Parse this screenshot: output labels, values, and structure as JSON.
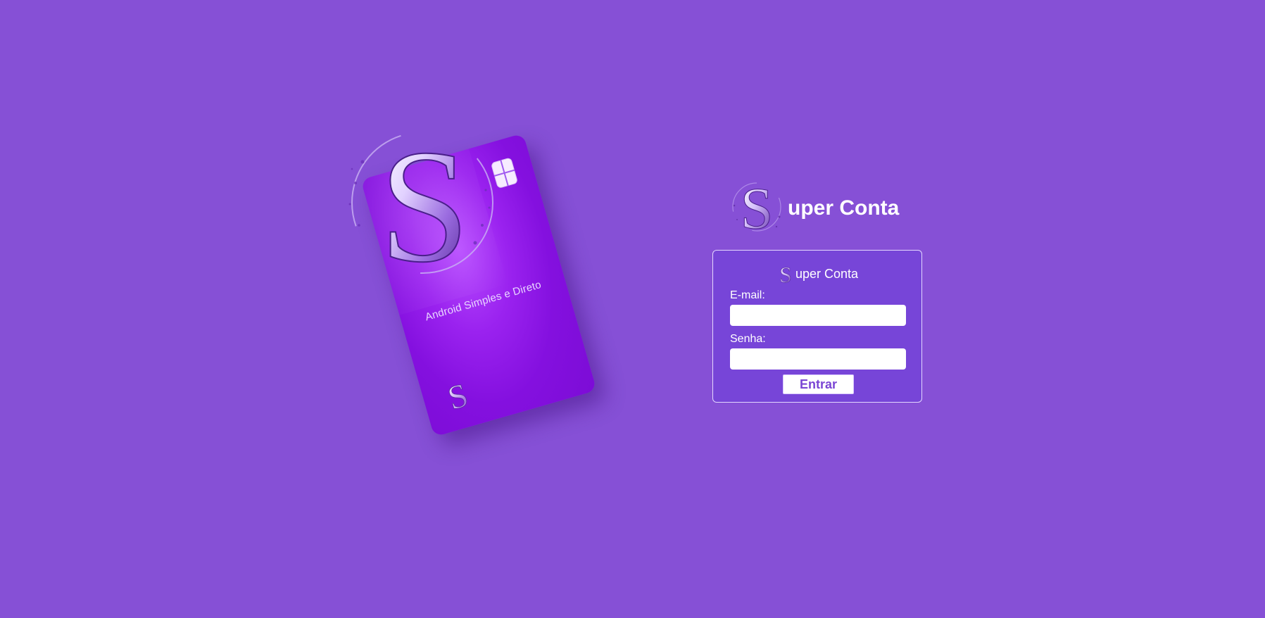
{
  "colors": {
    "background": "#8650d6",
    "login_box": "#7745d8",
    "card": "#8a16e4",
    "accent_text": "#7a45d4"
  },
  "card": {
    "tagline": "Android Simples e Direto",
    "logo_letter": "S"
  },
  "brand": {
    "logo_letter": "S",
    "name": "uper Conta"
  },
  "login": {
    "title_logo_letter": "S",
    "title": "uper Conta",
    "email_label": "E-mail:",
    "email_value": "",
    "password_label": "Senha:",
    "password_value": "",
    "submit_label": "Entrar"
  }
}
